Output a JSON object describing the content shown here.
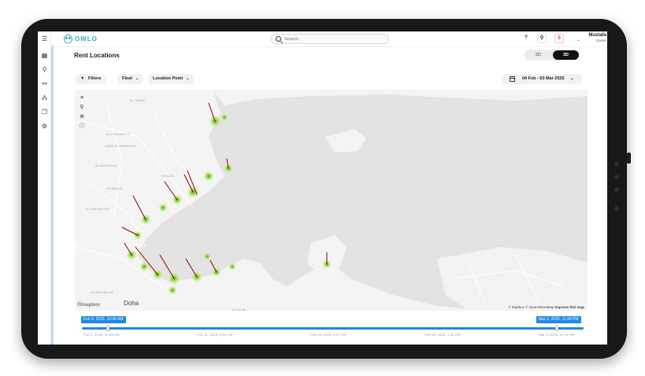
{
  "app": {
    "logo_text": "OWLO"
  },
  "header": {
    "search_placeholder": "Search..",
    "help_label": "?",
    "notification_count": "0",
    "user_name": "Mustafa",
    "user_role": "Owner"
  },
  "page": {
    "title": "Rent Locations",
    "view_toggle": {
      "options": [
        "2D",
        "3D"
      ],
      "selected": "3D"
    }
  },
  "filters": {
    "filters_label": "Filters",
    "fleet_label": "Fleet",
    "location_point_label": "Location Point",
    "date_range": "04 Feb - 03 Mar 2025"
  },
  "map": {
    "city_label": "Doha",
    "mapbox_logo": "mapbox",
    "attribution_mapbox": "© Mapbox",
    "attribution_osm": "© OpenStreetMap",
    "attribution_improve": "Improve this map",
    "tools": [
      "layers-icon",
      "search-icon",
      "locate-icon",
      "info-icon"
    ]
  },
  "timeline": {
    "start_label": "Feb 4, 2025, 10:46 AM",
    "end_label": "Mar 3, 2025, 11:48 PM",
    "ticks": [
      "Feb 4, 2025, 10:46 AM",
      "Feb 11, 2025, 8:02 AM",
      "Feb 18, 2025, 5:17 AM",
      "Feb 25, 2025, 2:33 AM",
      "Mar 3, 2025, 11:48 PM"
    ]
  },
  "colors": {
    "accent": "#1e88e5",
    "logo": "#35a7c9",
    "heat": "#7ed321",
    "spike": "#8b0000"
  }
}
